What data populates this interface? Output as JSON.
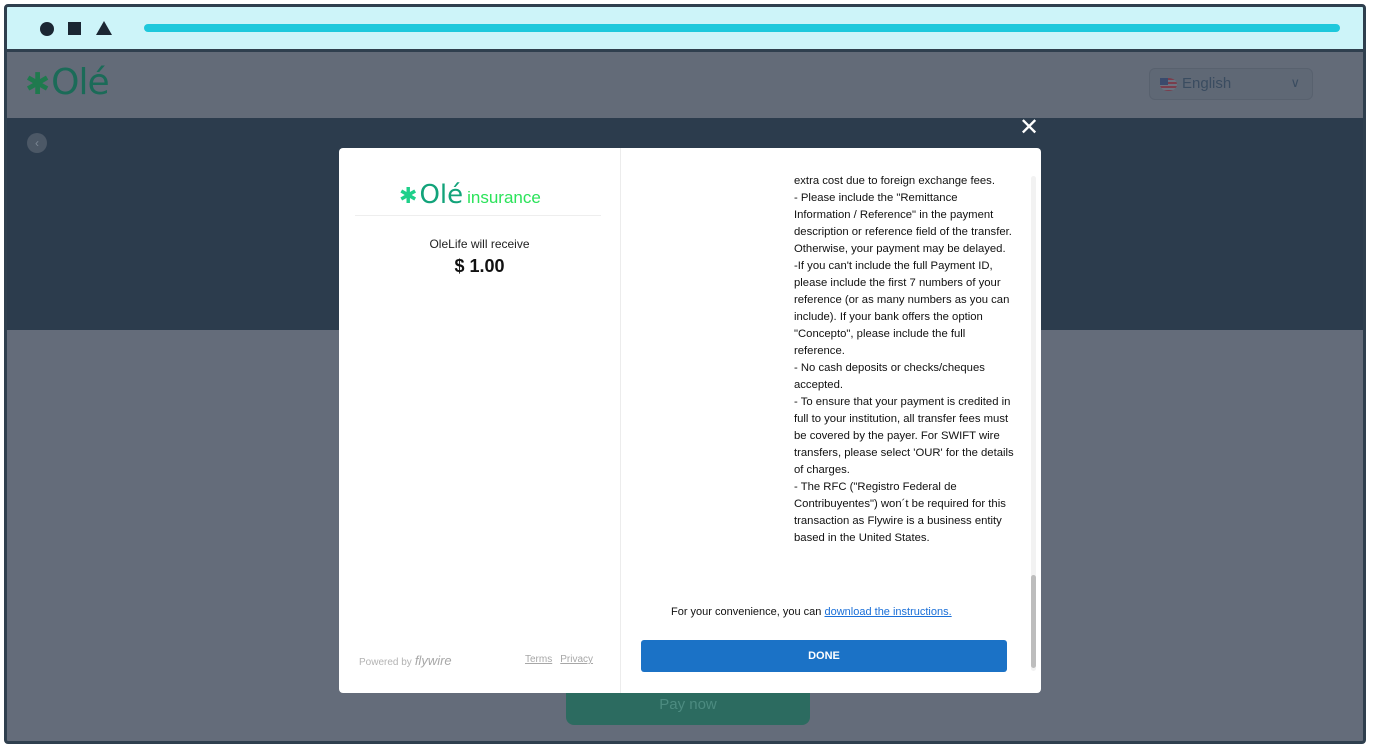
{
  "header": {
    "logo_text": "Olé",
    "language": "English"
  },
  "page": {
    "pay_now_label": "Pay now"
  },
  "modal": {
    "logo_main": "Olé",
    "logo_sub": "insurance",
    "receive_label": "OleLife will receive",
    "amount": "$ 1.00",
    "instructions_text": "extra cost due to foreign exchange fees.\n- Please include the \"Remittance Information / Reference\" in the payment description or reference field of the transfer. Otherwise, your payment may be delayed.\n-If you can't include the full Payment ID, please include the first 7 numbers of your reference (or as many numbers as you can include). If your bank offers the option \"Concepto\", please include the full reference.\n- No cash deposits or checks/cheques accepted.\n- To ensure that your payment is credited in full to your institution, all transfer fees must be covered by the payer. For SWIFT wire transfers, please select 'OUR' for the details of charges.\n- The RFC (\"Registro Federal de Contribuyentes\") won´t be required for this transaction as Flywire is a business entity based in the United States.",
    "convenience_text": "For your convenience, you can ",
    "download_link": "download the instructions.",
    "done_label": "DONE",
    "powered_by": "Powered by",
    "powered_brand": "flywire",
    "terms_label": "Terms",
    "privacy_label": "Privacy"
  }
}
